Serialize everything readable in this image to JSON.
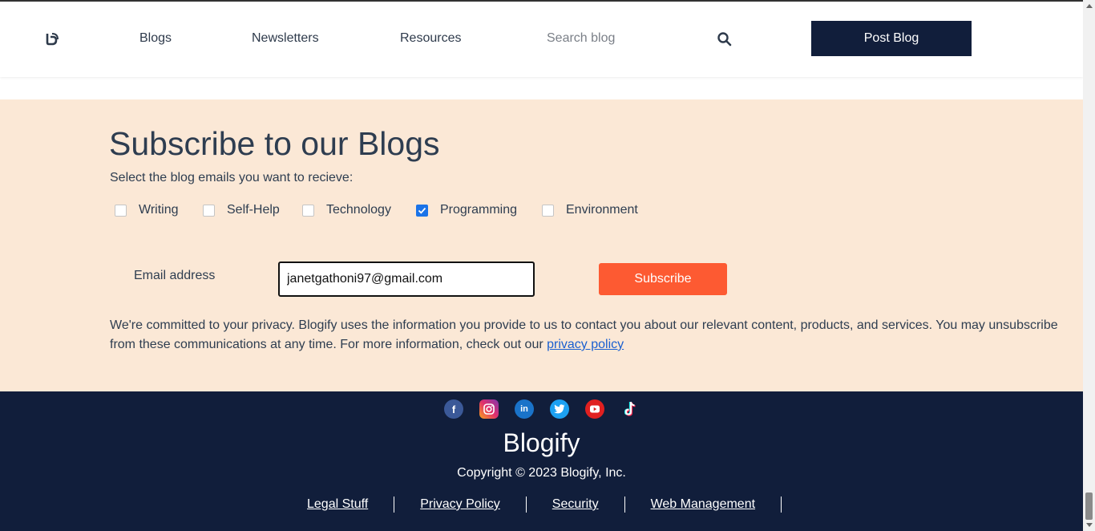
{
  "header": {
    "nav": [
      "Blogs",
      "Newsletters",
      "Resources"
    ],
    "search_placeholder": "Search blog",
    "post_button": "Post Blog"
  },
  "subscribe": {
    "title": "Subscribe to our Blogs",
    "description": "Select the blog emails you want to recieve:",
    "options": [
      {
        "label": "Writing",
        "checked": false
      },
      {
        "label": "Self-Help",
        "checked": false
      },
      {
        "label": "Technology",
        "checked": false
      },
      {
        "label": "Programming",
        "checked": true
      },
      {
        "label": "Environment",
        "checked": false
      }
    ],
    "email_label": "Email address",
    "email_value": "janetgathoni97@gmail.com",
    "button": "Subscribe",
    "privacy_text": "We're committed to your privacy. Blogify uses the information you provide to us to contact you about our relevant content, products, and services. You may unsubscribe from these communications at any time. For more information, check out our ",
    "privacy_link": "privacy policy"
  },
  "footer": {
    "socials": [
      "facebook-icon",
      "instagram-icon",
      "linkedin-icon",
      "twitter-icon",
      "youtube-icon",
      "tiktok-icon"
    ],
    "brand": "Blogify",
    "copyright": "Copyright © 2023 Blogify, Inc.",
    "links": [
      "Legal Stuff",
      "Privacy Policy",
      "Security",
      "Web Management"
    ]
  },
  "colors": {
    "navy": "#111e3b",
    "accent": "#fd5a32",
    "section_bg": "#fbe8d6"
  }
}
